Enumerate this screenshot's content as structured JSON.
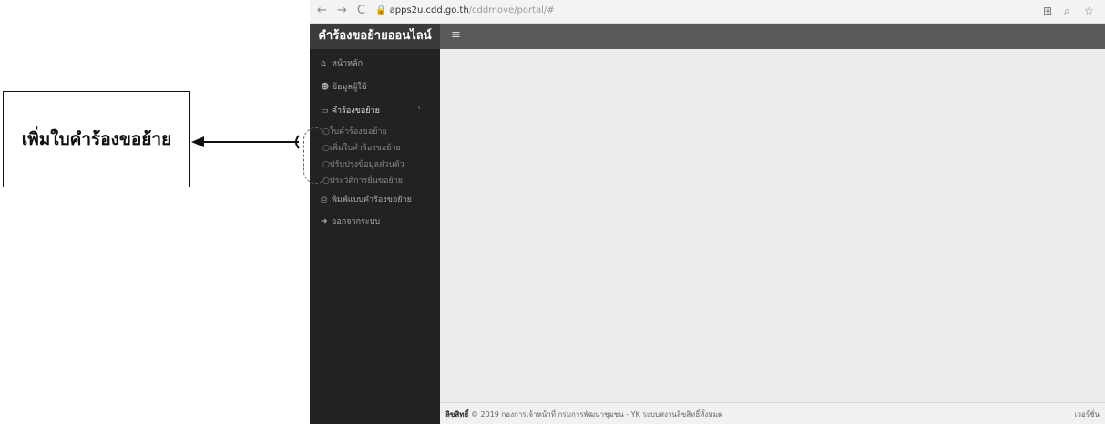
{
  "callout": {
    "label": "เพิ่มใบคำร้องขอย้าย"
  },
  "browser": {
    "back": "←",
    "forward": "→",
    "reload": "C",
    "url_domain": "apps2u.cdd.go.th",
    "url_path": "/cddmove/portal/#"
  },
  "header": {
    "title": "คำร้องขอย้ายออนไลน์",
    "menu_icon": "≡"
  },
  "sidebar": {
    "items": [
      {
        "label": "หน้าหลัก"
      },
      {
        "label": "ข้อมูลผู้ใช้"
      },
      {
        "label": "คำร้องขอย้าย"
      },
      {
        "label": "พิมพ์แบบคำร้องขอย้าย"
      },
      {
        "label": "ออกจากระบบ"
      }
    ],
    "subitems": [
      {
        "label": "ใบคำร้องขอย้าย"
      },
      {
        "label": "เพิ่มใบคำร้องขอย้าย"
      },
      {
        "label": "ปรับปรุงข้อมูลส่วนตัว"
      },
      {
        "label": "ประวัติการยื่นขอย้าย"
      }
    ]
  },
  "footer": {
    "copyright_label": "ลิขสิทธิ์",
    "copyright_text": "© 2019 กองการเจ้าหน้าที่ กรมการพัฒนาชุมชน - YK ระบบสงวนลิขสิทธิ์ทั้งหมด",
    "version": "เวอร์ชั่น"
  }
}
